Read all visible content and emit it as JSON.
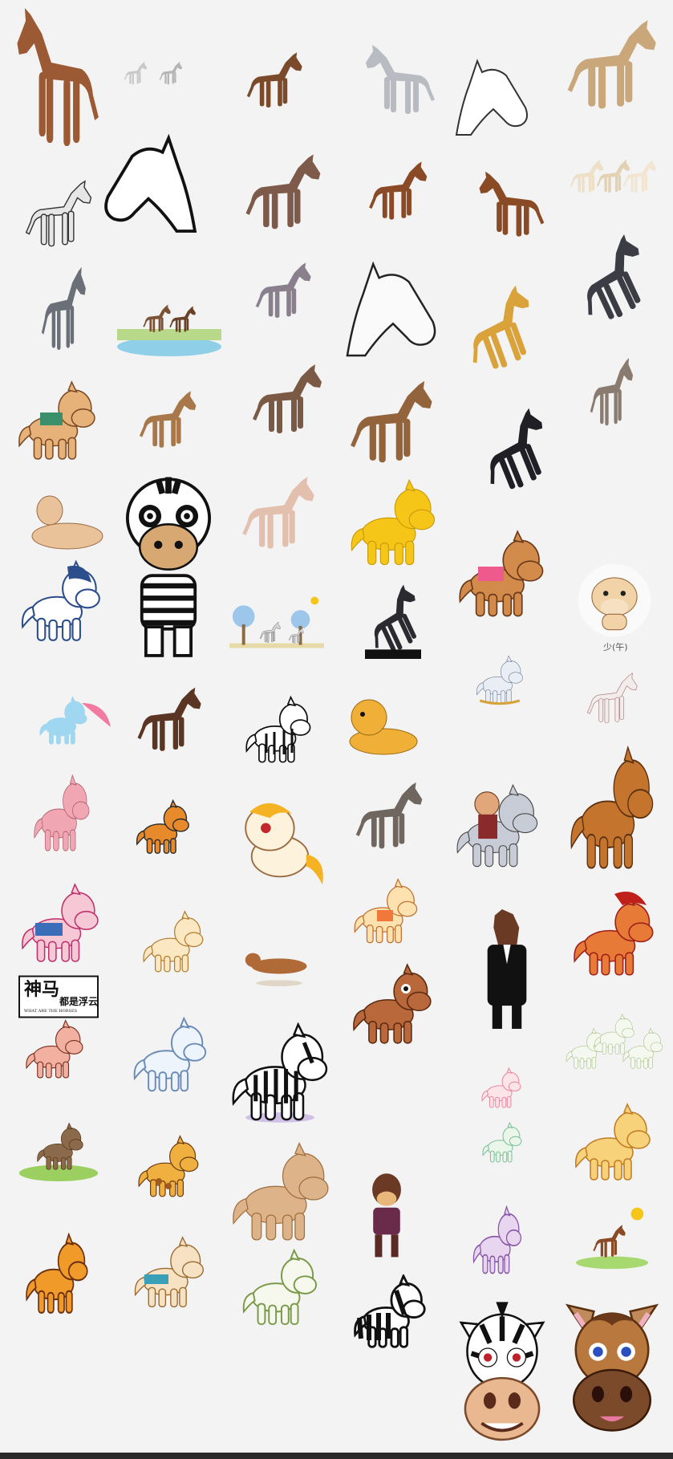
{
  "image": {
    "background": "#f3f3f3",
    "subject": "horses",
    "captions": {
      "ox_label": "少(午)"
    },
    "logo": {
      "text": "神马",
      "subtext": "都是浮云",
      "small_text": "WHAT ARE THE HORSES"
    },
    "colors": {
      "brown": "#9b5a34",
      "chestnut": "#8a4a25",
      "tan": "#c8a27a",
      "grey": "#7e7e88",
      "cream": "#f2e7cf",
      "yellow": "#f5c518",
      "orange": "#e78a2b",
      "pink": "#f0a7b3",
      "black": "#1c1c1c"
    }
  }
}
